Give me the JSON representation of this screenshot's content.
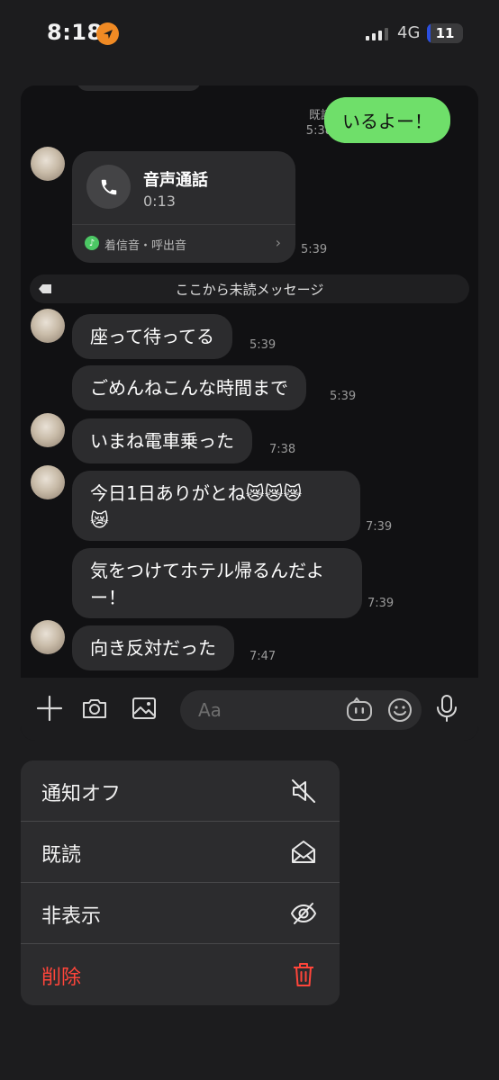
{
  "status_bar": {
    "time": "8:18",
    "network": "4G",
    "battery": "11"
  },
  "chat": {
    "read_label": "既読",
    "messages": [
      {
        "from": "me",
        "text": "いるよー！",
        "time": "5:38"
      },
      {
        "from": "them",
        "kind": "call",
        "title": "音声通話",
        "duration": "0:13",
        "ringtone_label": "着信音・呼出音",
        "time": "5:39"
      },
      {
        "from": "them",
        "text": "座って待ってる",
        "time": "5:39"
      },
      {
        "from": "them",
        "text": "ごめんねこんな時間まで",
        "time": "5:39"
      },
      {
        "from": "them",
        "text": "いまね電車乗った",
        "time": "7:38"
      },
      {
        "from": "them",
        "line1": "今日1日ありがとね😿😿😿",
        "line2": "😿",
        "time": "7:39"
      },
      {
        "from": "them",
        "line1": "気をつけてホテル帰るんだよ",
        "line2": "ー！",
        "time": "7:39"
      },
      {
        "from": "them",
        "text": "向き反対だった",
        "time": "7:47"
      }
    ],
    "unread_divider": "ここから未読メッセージ",
    "input_placeholder": "Aa"
  },
  "menu": {
    "items": [
      {
        "label": "通知オフ",
        "icon": "speaker-mute-icon"
      },
      {
        "label": "既読",
        "icon": "open-envelope-icon"
      },
      {
        "label": "非表示",
        "icon": "eye-slash-icon"
      },
      {
        "label": "削除",
        "icon": "trash-icon",
        "color": "#ff453a"
      }
    ]
  },
  "colors": {
    "my_bubble": "#6fdf6a",
    "their_bubble": "#2c2c2e",
    "danger": "#ff453a",
    "location": "#f08a24",
    "battery": "#2b4fe0"
  }
}
